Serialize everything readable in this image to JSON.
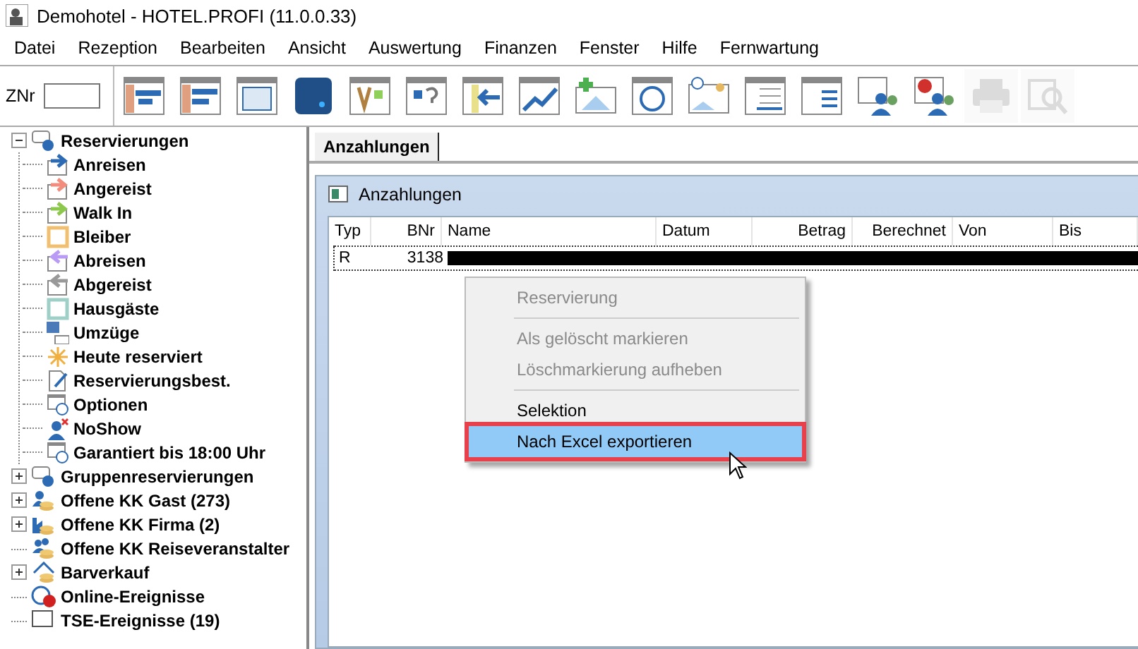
{
  "window": {
    "title": "Demohotel - HOTEL.PROFI (11.0.0.33)"
  },
  "menu": [
    "Datei",
    "Rezeption",
    "Bearbeiten",
    "Ansicht",
    "Auswertung",
    "Finanzen",
    "Fenster",
    "Hilfe",
    "Fernwartung"
  ],
  "toolbar": {
    "field_label": "ZNr",
    "buttons": [
      {
        "disabled": false
      },
      {
        "disabled": false
      },
      {
        "disabled": false
      },
      {
        "disabled": false
      },
      {
        "disabled": false
      },
      {
        "disabled": false
      },
      {
        "disabled": false
      },
      {
        "disabled": false
      },
      {
        "disabled": false
      },
      {
        "disabled": false
      },
      {
        "disabled": false
      },
      {
        "disabled": false
      },
      {
        "disabled": false
      },
      {
        "disabled": false
      },
      {
        "disabled": false
      },
      {
        "disabled": true
      },
      {
        "disabled": true
      }
    ]
  },
  "tree": [
    {
      "label": "Reservierungen",
      "expandable": true,
      "expanded": true,
      "children": [
        {
          "label": "Anreisen"
        },
        {
          "label": "Angereist"
        },
        {
          "label": "Walk In"
        },
        {
          "label": "Bleiber"
        },
        {
          "label": "Abreisen"
        },
        {
          "label": "Abgereist"
        },
        {
          "label": "Hausgäste"
        },
        {
          "label": "Umzüge"
        },
        {
          "label": "Heute reserviert"
        },
        {
          "label": "Reservierungsbest."
        },
        {
          "label": "Optionen"
        },
        {
          "label": "NoShow"
        },
        {
          "label": "Garantiert bis 18:00 Uhr"
        }
      ]
    },
    {
      "label": "Gruppenreservierungen",
      "expandable": true,
      "expanded": false
    },
    {
      "label": "Offene KK Gast (273)",
      "expandable": true,
      "expanded": false
    },
    {
      "label": "Offene KK Firma (2)",
      "expandable": true,
      "expanded": false
    },
    {
      "label": "Offene KK Reiseveranstalter",
      "expandable": false
    },
    {
      "label": "Barverkauf",
      "expandable": true,
      "expanded": false
    },
    {
      "label": "Online-Ereignisse",
      "expandable": false
    },
    {
      "label": "TSE-Ereignisse (19)",
      "expandable": false
    }
  ],
  "tabs": [
    {
      "label": "Anzahlungen",
      "selected": true
    }
  ],
  "inner_window": {
    "title": "Anzahlungen",
    "table": {
      "columns": [
        "Typ",
        "BNr",
        "Name",
        "Datum",
        "Betrag",
        "Berechnet",
        "Von",
        "Bis"
      ],
      "rows": [
        {
          "typ": "R",
          "bnr": "3138",
          "name_redacted": true
        }
      ]
    }
  },
  "context_menu": [
    {
      "kind": "item",
      "label": "Reservierung",
      "disabled": true,
      "selected": false
    },
    {
      "kind": "separator"
    },
    {
      "kind": "item",
      "label": "Als gelöscht markieren",
      "disabled": true,
      "selected": false
    },
    {
      "kind": "item",
      "label": "Löschmarkierung aufheben",
      "disabled": true,
      "selected": false
    },
    {
      "kind": "separator"
    },
    {
      "kind": "item",
      "label": "Selektion",
      "disabled": false,
      "selected": false
    },
    {
      "kind": "item",
      "label": "Nach Excel exportieren",
      "disabled": false,
      "selected": true
    }
  ]
}
